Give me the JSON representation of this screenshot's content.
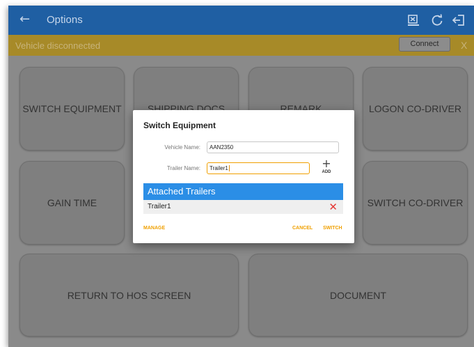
{
  "appbar": {
    "back_icon": "←",
    "title": "Options",
    "icons": [
      "export-icon",
      "refresh-icon",
      "logout-icon"
    ]
  },
  "alert": {
    "message": "Vehicle disconnected",
    "connect_label": "Connect",
    "close_label": "X"
  },
  "tiles": {
    "switch_equipment": "SWITCH EQUIPMENT",
    "shipping_docs": "SHIPPING DOCS",
    "remark": "REMARK",
    "logon_codriver": "LOGON CO-DRIVER",
    "gain_time": "GAIN TIME",
    "switch_codriver": "SWITCH CO-DRIVER",
    "return_hos": "RETURN TO HOS SCREEN",
    "document": "DOCUMENT"
  },
  "dialog": {
    "title": "Switch Equipment",
    "vehicle_label": "Vehicle Name:",
    "vehicle_value": "AAN2350",
    "trailer_label": "Trailer Name:",
    "trailer_value": "Trailer1",
    "add_icon": "+",
    "add_label": "ADD",
    "list_header": "Attached Trailers",
    "list_items": [
      "Trailer1"
    ],
    "remove_icon": "✕",
    "manage_label": "MANAGE",
    "cancel_label": "CANCEL",
    "switch_label": "SWITCH"
  },
  "colors": {
    "appbar": "#1f5fa3",
    "alert": "#a78a28",
    "accent": "#f0a000",
    "list_header": "#2b8ee6",
    "remove": "#e53935"
  }
}
